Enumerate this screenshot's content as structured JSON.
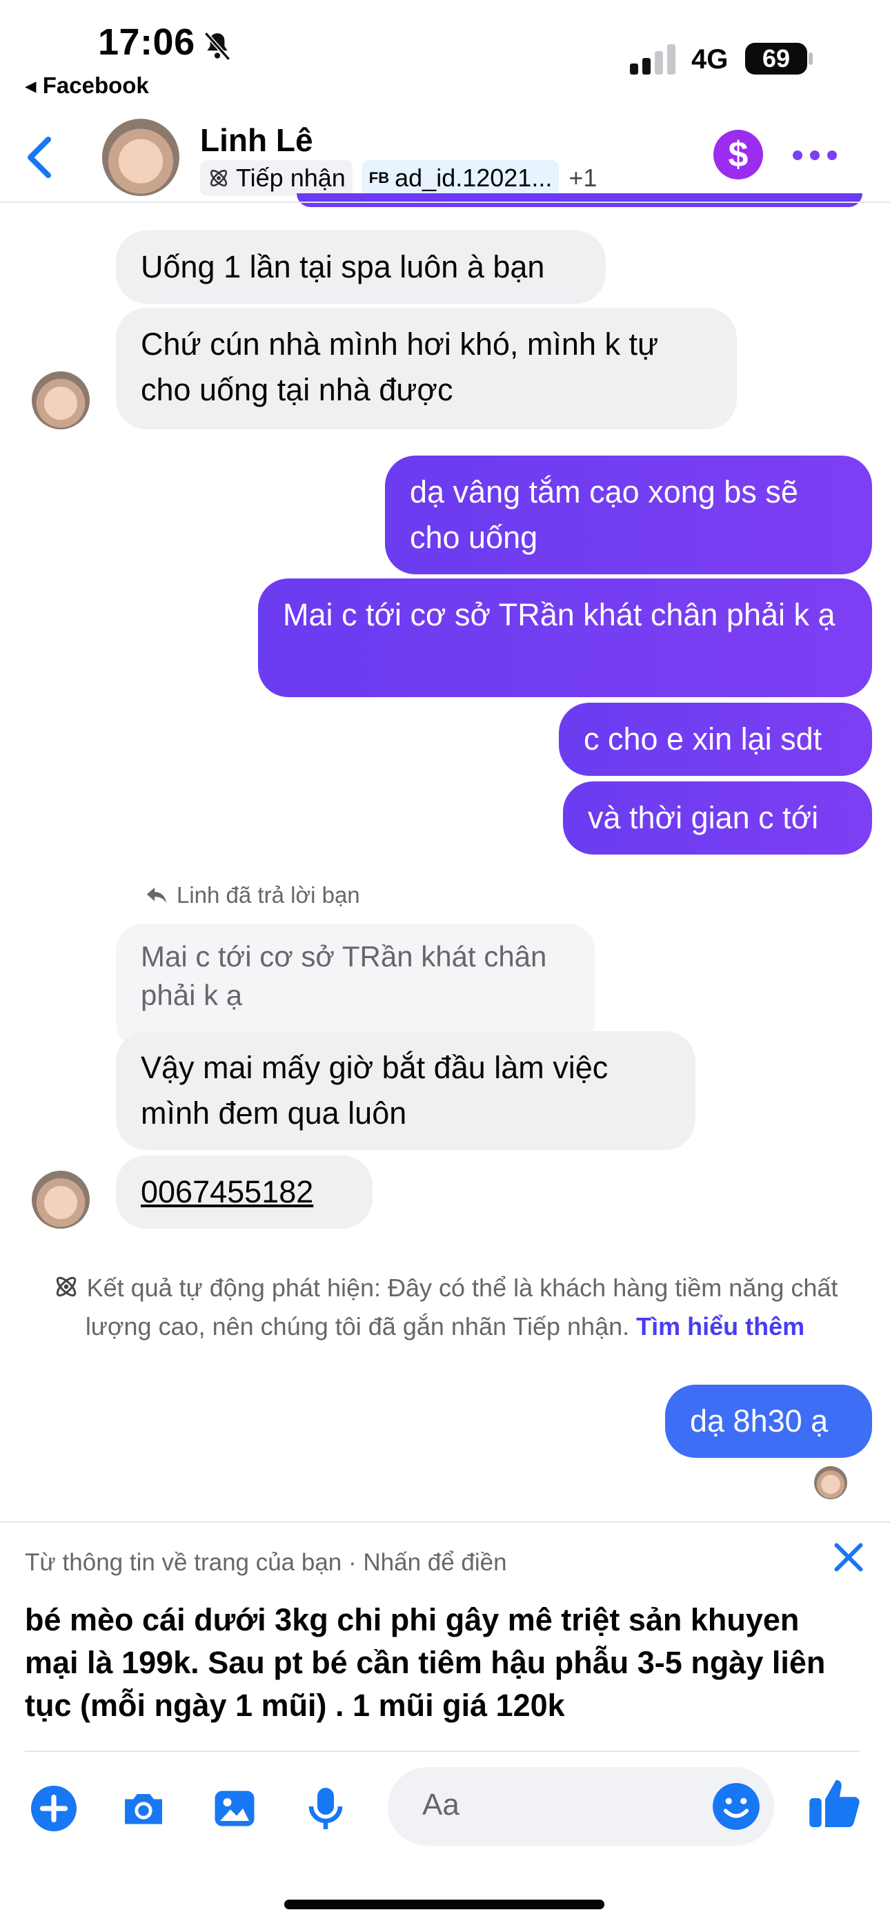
{
  "status_bar": {
    "time": "17:06",
    "back_app": "◂ Facebook",
    "network": "4G",
    "battery": "69"
  },
  "header": {
    "name": "Linh Lê",
    "label_tag": "Tiếp nhận",
    "ad_prefix": "FB",
    "ad_tag": "ad_id.12021...",
    "extra_tags": "+1"
  },
  "messages": {
    "in1": "Uống 1 lần tại spa luôn à bạn",
    "in2": "Chứ cún nhà mình hơi khó, mình k tự cho uống tại nhà được",
    "out1": "dạ vâng tắm cạo xong bs sẽ cho uống",
    "out2": "Mai c tới cơ sở TRần khát chân phải k ạ",
    "out3": "c cho e xin lại sdt",
    "out4": "và thời gian c tới",
    "reply_note": "Linh đã trả lời bạn",
    "quoted": "Mai c tới cơ sở TRần khát chân phải k ạ",
    "in3": "Vậy mai mấy giờ bắt đầu làm việc mình đem qua luôn",
    "in4": "0067455182",
    "out5": "dạ 8h30 ạ"
  },
  "auto_detect": {
    "text": "Kết quả tự động phát hiện: Đây có thể là khách hàng tiềm năng chất lượng cao, nên chúng tôi đã gắn nhãn Tiếp nhận.",
    "link": "Tìm hiểu thêm"
  },
  "suggestion": {
    "source": "Từ thông tin về trang của bạn · Nhấn để điền",
    "text": "bé mèo cái dưới 3kg chi phi gây mê triệt sản khuyen mại là 199k. Sau pt bé cần tiêm hậu phẫu 3-5 ngày liên tục (mỗi ngày 1 mũi) . 1 mũi giá 120k"
  },
  "composer": {
    "placeholder": "Aa"
  },
  "colors": {
    "accent": "#7b3ff2",
    "link": "#4a3cf0",
    "outgoing": "#6b3cf0",
    "outgoing_last": "#3d6ef5",
    "incoming": "#f0f0f3"
  },
  "icons": [
    "bell-slash-icon",
    "signal-icon",
    "back-chevron-icon",
    "dollar-icon",
    "more-icon",
    "atom-icon",
    "reply-arrow-icon",
    "close-icon",
    "plus-icon",
    "camera-icon",
    "photo-icon",
    "mic-icon",
    "emoji-icon",
    "thumbs-up-icon"
  ]
}
